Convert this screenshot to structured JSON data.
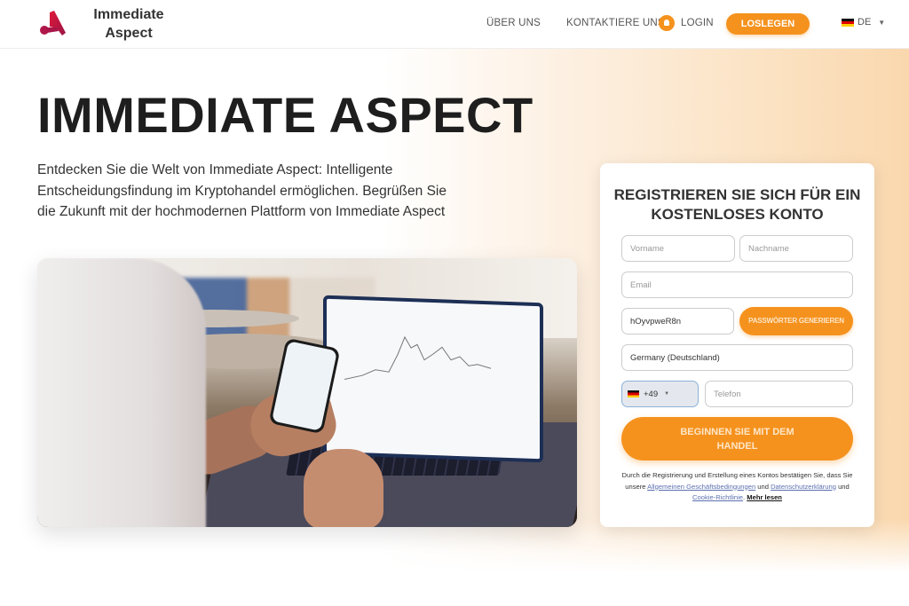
{
  "header": {
    "brand": "Immediate Aspect",
    "brand_line1": "Immediate",
    "brand_line2": "Aspect",
    "nav": {
      "about": "ÜBER UNS",
      "contact": "KONTAKTIERE UNS",
      "login": "LOGIN",
      "start": "LOSLEGEN"
    },
    "language": "DE",
    "login_icon": "user-icon",
    "flag_icon": "germany-flag-icon"
  },
  "hero": {
    "title": "IMMEDIATE ASPECT",
    "description": "Entdecken Sie die Welt von Immediate Aspect: Intelligente Entscheidungsfindung im Kryptohandel ermöglichen. Begrüßen Sie die Zukunft mit der hochmodernen Plattform von Immediate Aspect",
    "image": "person-trading-on-laptop-and-phone-photo"
  },
  "form": {
    "title": "REGISTRIEREN SIE SICH FÜR EIN KOSTENLOSES KONTO",
    "first_name_placeholder": "Vorname",
    "last_name_placeholder": "Nachname",
    "email_placeholder": "Email",
    "password_value": "hOyvpweR8n",
    "generate_button": "PASSWÖRTER GENERIEREN",
    "country_value": "Germany (Deutschland)",
    "phone_code": "+49",
    "phone_placeholder": "Telefon",
    "submit_button": "BEGINNEN SIE MIT DEM HANDEL",
    "terms": {
      "text1": "Durch die Registrierung und Erstellung eines Kontos bestätigen Sie, dass Sie unsere ",
      "link_terms": "Allgemeinen Geschäftsbedingungen",
      "text2": " und ",
      "link_privacy": "Datenschutzerklärung",
      "text3": " und ",
      "link_cookie": "Cookie-Richtlinie",
      "text4": ". ",
      "read_more": "Mehr lesen"
    }
  },
  "colors": {
    "accent": "#f5921e",
    "logo": "#c2163f",
    "text_dark": "#1e1e1e"
  }
}
